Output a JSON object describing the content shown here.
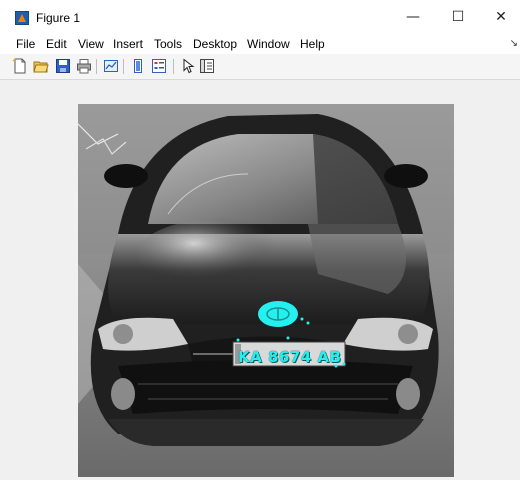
{
  "window": {
    "title": "Figure 1",
    "minimize_glyph": "—",
    "maximize_glyph": "☐",
    "close_glyph": "✕"
  },
  "menu": {
    "items": [
      "File",
      "Edit",
      "View",
      "Insert",
      "Tools",
      "Desktop",
      "Window",
      "Help"
    ],
    "extra_glyph": "↘"
  },
  "toolbar": {
    "icons": [
      "new-figure-icon",
      "open-file-icon",
      "save-icon",
      "print-icon",
      "link-plot-icon",
      "insert-colorbar-icon",
      "insert-legend-icon",
      "edit-plot-icon",
      "property-inspector-icon"
    ]
  },
  "figure": {
    "plate_text": "KA 8674 AB",
    "highlight_color": "#24f1ef"
  }
}
